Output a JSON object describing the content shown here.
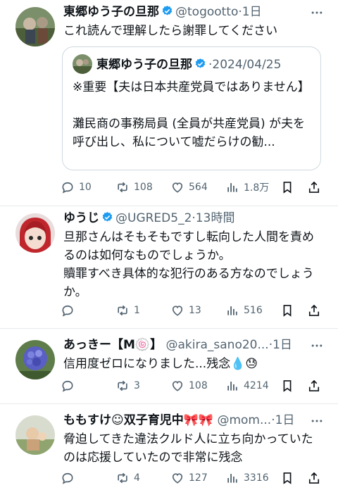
{
  "posts": [
    {
      "name": "東郷ゆう子の旦那",
      "handle": "@togootto",
      "time": "·1日",
      "text": "これ読んで理解したら謝罪してください",
      "quote": {
        "name": "東郷ゆう子の旦那",
        "date": "2024/04/25",
        "text": "※重要【夫は日本共産党員ではありません】\n\n灘民商の事務局員 (全員が共産党員) が夫を呼び出し、私について嘘だらけの勧..."
      },
      "replies": "10",
      "reposts": "108",
      "likes": "564",
      "views": "1.8万"
    },
    {
      "name": "ゆうじ",
      "handle": "@UGRED5_2",
      "time": "·13時間",
      "text": "旦那さんはそもそもですし転向した人間を責めるのは如何なものでしょうか。\n贖罪すべき具体的な犯行のある方なのでしょうか。",
      "replies": "",
      "reposts": "1",
      "likes": "13",
      "views": "516"
    },
    {
      "name": "あっきー【M🍥】",
      "handle": "@akira_sano20...",
      "time": "·1日",
      "text": "信用度ゼロになりました...残念💧😓",
      "replies": "",
      "reposts": "3",
      "likes": "108",
      "views": "4214"
    },
    {
      "name": "ももすけ☺双子育児中🎀🎀",
      "handle": "@mom...",
      "time": "·1日",
      "text": "脅迫してきた違法クルド人に立ち向かっていたのは応援していたので非常に残念",
      "replies": "",
      "reposts": "4",
      "likes": "127",
      "views": "3316"
    }
  ],
  "colors": {
    "text": "#0f1419",
    "secondary": "#536471",
    "verified": "#1d9bf0",
    "border": "#cfd9de"
  },
  "icons": [
    "verified-badge-icon",
    "more-icon",
    "reply-icon",
    "repost-icon",
    "like-icon",
    "views-icon",
    "bookmark-icon",
    "share-icon"
  ]
}
